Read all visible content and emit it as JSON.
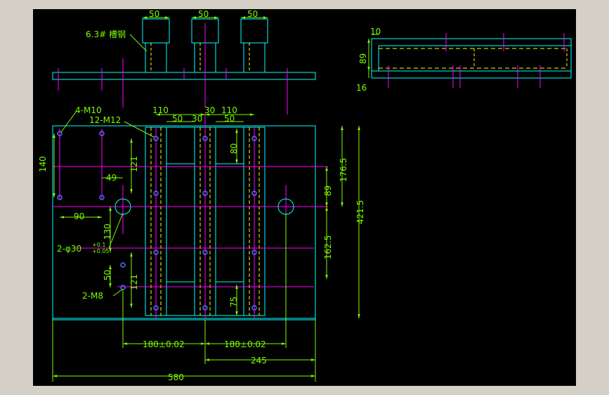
{
  "colors": {
    "background": "#000000",
    "outline": "#00FFFF",
    "dimension": "#7CFC00",
    "center_line": "#FF00FF",
    "hidden_line": "#FFFF00",
    "hole": "#4F6BFF",
    "chrome": "#D4D0C8"
  },
  "top_view": {
    "label_channel": "6.3# 槽钢",
    "widths": [
      "50",
      "50",
      "50"
    ]
  },
  "side_view": {
    "dims": [
      "10",
      "89",
      "16"
    ]
  },
  "plan_view": {
    "hole_labels": [
      "4-M10",
      "12-M12",
      "2-φ30",
      "2-M8"
    ],
    "tol_upper": "+0.1",
    "tol_lower": "+0.05",
    "dims_top": [
      "110",
      "30",
      "110",
      "50",
      "30",
      "50"
    ],
    "dims_left": [
      "140",
      "90",
      "49",
      "121",
      "130",
      "50",
      "121"
    ],
    "dims_inner": [
      "80",
      "75"
    ],
    "dims_right": [
      "176.5",
      "89",
      "421.5",
      "162.5"
    ],
    "dims_bottom": [
      "180±0.02",
      "180±0.02",
      "245",
      "580"
    ]
  }
}
